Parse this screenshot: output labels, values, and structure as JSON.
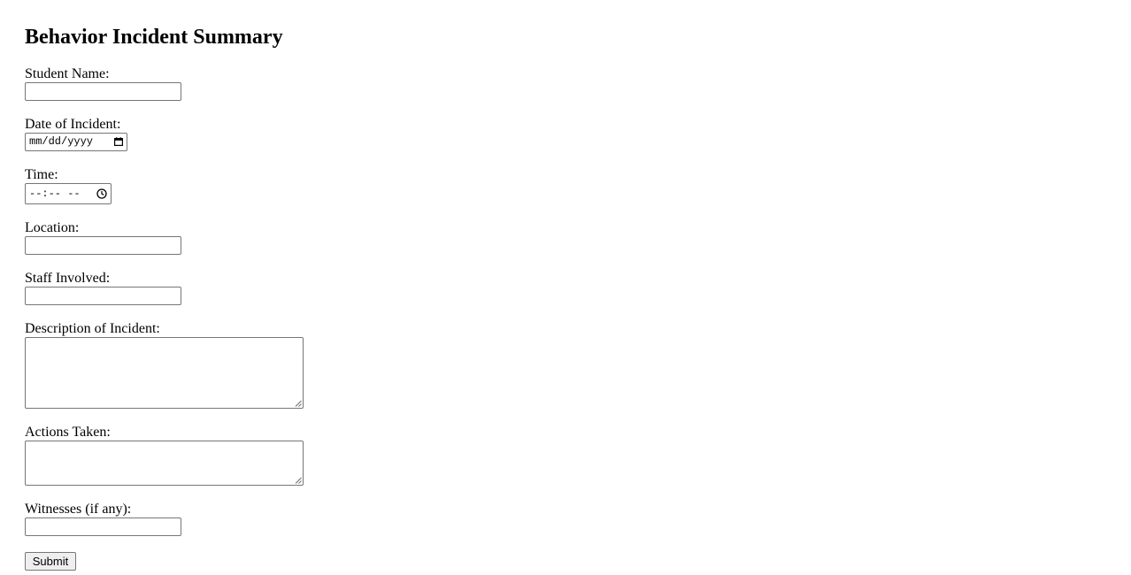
{
  "form": {
    "title": "Behavior Incident Summary",
    "fields": {
      "student_name": {
        "label": "Student Name:",
        "value": ""
      },
      "date": {
        "label": "Date of Incident:",
        "placeholder": "mm/dd/yyyy"
      },
      "time": {
        "label": "Time:",
        "placeholder": "--:-- --"
      },
      "location": {
        "label": "Location:",
        "value": ""
      },
      "staff": {
        "label": "Staff Involved:",
        "value": ""
      },
      "description": {
        "label": "Description of Incident:",
        "value": ""
      },
      "actions": {
        "label": "Actions Taken:",
        "value": ""
      },
      "witnesses": {
        "label": "Witnesses (if any):",
        "value": ""
      }
    },
    "submit_label": "Submit"
  },
  "icons": {
    "date": "calendar-icon",
    "time": "clock-icon",
    "textarea": "resize-handle-icon"
  },
  "colors": {
    "border": "#767676",
    "button_bg": "#efefef",
    "text": "#000000",
    "background": "#ffffff"
  }
}
